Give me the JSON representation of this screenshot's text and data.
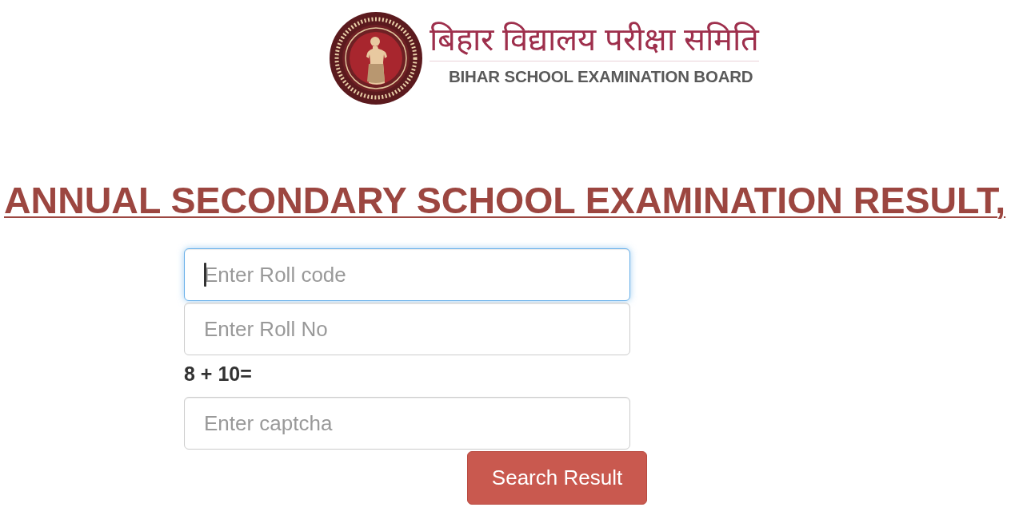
{
  "logo": {
    "title_hindi": "बिहार विद्यालय परीक्षा समिति",
    "title_english": "BIHAR SCHOOL EXAMINATION BOARD"
  },
  "heading": "ANNUAL SECONDARY SCHOOL EXAMINATION RESULT,",
  "form": {
    "items": [
      {
        "kind": "input",
        "placeholder": "Enter Roll code",
        "focused": true
      },
      {
        "kind": "input",
        "placeholder": "Enter Roll No",
        "focused": false
      },
      {
        "kind": "label",
        "text": "8 + 10="
      },
      {
        "kind": "input",
        "placeholder": "Enter captcha",
        "focused": false
      }
    ],
    "submit_button": "Search Result"
  }
}
